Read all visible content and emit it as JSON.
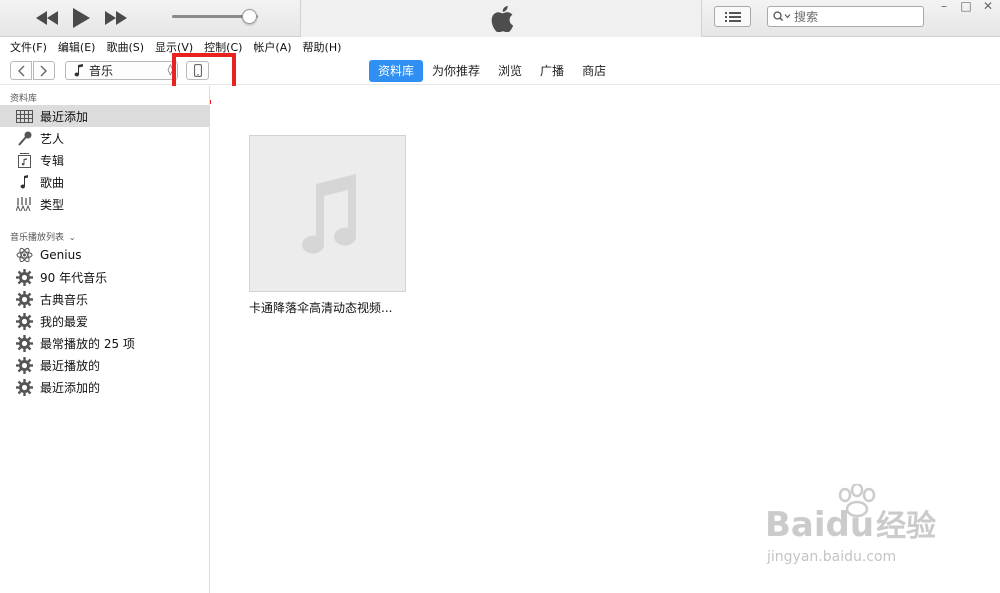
{
  "player": {
    "rewind_icon": "rewind-icon",
    "play_icon": "play-icon",
    "forward_icon": "fast-forward-icon",
    "volume_level": 0.9
  },
  "search": {
    "placeholder": "搜索"
  },
  "window_controls": {
    "minimize": "–",
    "maximize": "□",
    "close": "✕"
  },
  "menu": {
    "items": [
      "文件(F)",
      "编辑(E)",
      "歌曲(S)",
      "显示(V)",
      "控制(C)",
      "帐户(A)",
      "帮助(H)"
    ]
  },
  "nav": {
    "media_label": "音乐",
    "media_caret": "◊",
    "tabs": [
      "资料库",
      "为你推荐",
      "浏览",
      "广播",
      "商店"
    ],
    "active_tab": "资料库"
  },
  "sidebar": {
    "library_header": "资料库",
    "library_items": [
      {
        "label": "最近添加",
        "icon": "grid-icon",
        "selected": true
      },
      {
        "label": "艺人",
        "icon": "microphone-icon",
        "selected": false
      },
      {
        "label": "专辑",
        "icon": "album-icon",
        "selected": false
      },
      {
        "label": "歌曲",
        "icon": "music-note-icon",
        "selected": false
      },
      {
        "label": "类型",
        "icon": "genre-icon",
        "selected": false
      }
    ],
    "playlists_header": "音乐播放列表",
    "playlist_items": [
      {
        "label": "Genius",
        "icon": "genius-atom-icon"
      },
      {
        "label": "90 年代音乐",
        "icon": "gear-icon"
      },
      {
        "label": "古典音乐",
        "icon": "gear-icon"
      },
      {
        "label": "我的最爱",
        "icon": "gear-icon"
      },
      {
        "label": "最常播放的 25 项",
        "icon": "gear-icon"
      },
      {
        "label": "最近播放的",
        "icon": "gear-icon"
      },
      {
        "label": "最近添加的",
        "icon": "gear-icon"
      }
    ]
  },
  "content": {
    "albums": [
      {
        "title": "卡通降落伞高清动态视频..."
      }
    ]
  },
  "watermark": {
    "brand": "Bai",
    "brand2": "du",
    "brand_cn": "经验",
    "url": "jingyan.baidu.com"
  },
  "colors": {
    "accent": "#2f8ff3",
    "highlight_box": "#e8231f",
    "selected_row": "#dcdcdc"
  }
}
